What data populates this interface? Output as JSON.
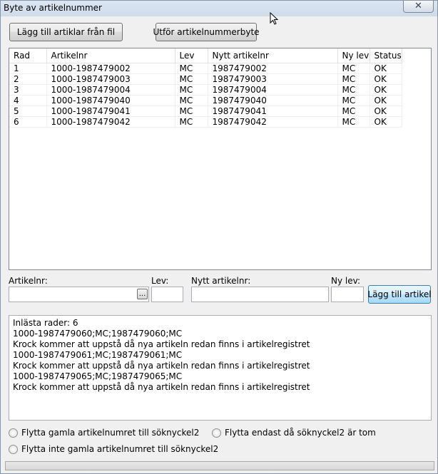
{
  "window": {
    "title": "Byte av artikelnummer",
    "close_glyph": "✕"
  },
  "toolbar": {
    "add_from_file_label": "Lägg till artiklar från fil",
    "run_swap_label": "Utför artikelnummerbyte"
  },
  "grid": {
    "columns": [
      "Rad",
      "Artikelnr",
      "Lev",
      "Nytt artikelnr",
      "Ny lev",
      "Status"
    ],
    "rows": [
      [
        "1",
        "1000-1987479002",
        "MC",
        "1987479002",
        "MC",
        "OK"
      ],
      [
        "2",
        "1000-1987479003",
        "MC",
        "1987479003",
        "MC",
        "OK"
      ],
      [
        "3",
        "1000-1987479004",
        "MC",
        "1987479004",
        "MC",
        "OK"
      ],
      [
        "4",
        "1000-1987479040",
        "MC",
        "1987479040",
        "MC",
        "OK"
      ],
      [
        "5",
        "1000-1987479041",
        "MC",
        "1987479041",
        "MC",
        "OK"
      ],
      [
        "6",
        "1000-1987479042",
        "MC",
        "1987479042",
        "MC",
        "OK"
      ]
    ]
  },
  "form": {
    "artikelnr_label": "Artikelnr:",
    "artikelnr_value": "",
    "lev_label": "Lev:",
    "lev_value": "",
    "nytt_label": "Nytt artikelnr:",
    "nytt_value": "",
    "nylev_label": "Ny lev:",
    "nylev_value": "",
    "browse_label": "...",
    "add_label": "Lägg till artikel"
  },
  "log": {
    "lines": [
      "Inlästa rader: 6",
      "1000-1987479060;MC;1987479060;MC",
      "Krock kommer att uppstå då nya artikeln redan finns i artikelregistret",
      "1000-1987479061;MC;1987479061;MC",
      "Krock kommer att uppstå då nya artikeln redan finns i artikelregistret",
      "1000-1987479065;MC;1987479065;MC",
      "Krock kommer att uppstå då nya artikeln redan finns i artikelregistret"
    ]
  },
  "options": {
    "move_old": "Flytta gamla artikelnumret till söknyckel2",
    "move_if_empty": "Flytta endast då söknyckel2 är tom",
    "dont_move": "Flytta inte gamla artikelnumret till söknyckel2"
  }
}
